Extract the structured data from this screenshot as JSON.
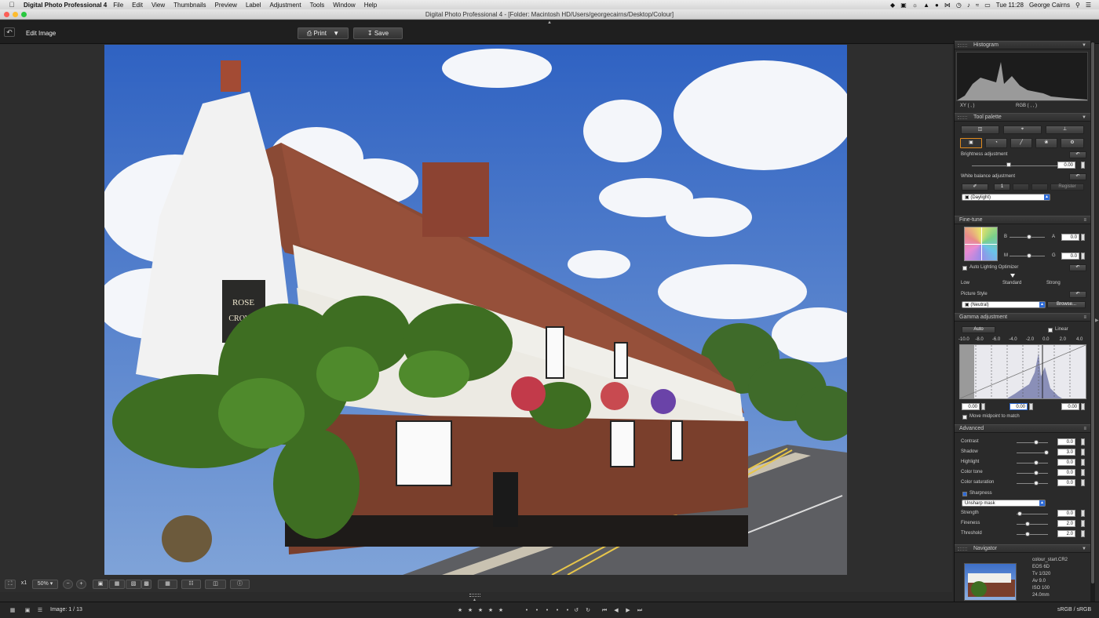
{
  "menubar": {
    "app_name": "Digital Photo Professional 4",
    "items": [
      "File",
      "Edit",
      "View",
      "Thumbnails",
      "Preview",
      "Label",
      "Adjustment",
      "Tools",
      "Window",
      "Help"
    ],
    "clock": "Tue 11:28",
    "user": "George Cairns"
  },
  "window": {
    "title": "Digital Photo Professional 4 - [Folder: Macintosh HD/Users/georgecairns/Desktop/Colour]"
  },
  "toolbar": {
    "mode_title": "Edit Image",
    "print_label": "Print",
    "save_label": "Save"
  },
  "histogram_panel": {
    "title": "Histogram",
    "xy_readout": "XY (          ,          )",
    "rgb_readout": "RGB (          ,          ,          )"
  },
  "tool_palette": {
    "title": "Tool palette",
    "brightness_label": "Brightness adjustment",
    "brightness_value": "0.00",
    "white_balance_label": "White balance adjustment",
    "wb_value": "1",
    "wb_register": "Register",
    "wb_preset": "(Daylight)"
  },
  "fine_tune": {
    "title": "Fine-tune",
    "b_label": "B",
    "a_label": "A",
    "m_label": "M",
    "g_label": "G",
    "ba_value": "0.0",
    "mg_value": "0.0",
    "alo_label": "Auto Lighting Optimizer",
    "alo_low": "Low",
    "alo_standard": "Standard",
    "alo_strong": "Strong",
    "picture_style_label": "Picture Style",
    "picture_style_value": "(Neutral)",
    "browse_label": "Browse..."
  },
  "gamma": {
    "title": "Gamma adjustment",
    "auto_label": "Auto",
    "linear_label": "Linear",
    "scale": [
      "-10.0",
      "-8.0",
      "-6.0",
      "-4.0",
      "-2.0",
      "0.0",
      "2.0",
      "4.0"
    ],
    "black_value": "0.00",
    "mid_value": "0.00",
    "white_value": "0.00",
    "move_midpoint_label": "Move midpoint to match"
  },
  "advanced": {
    "title": "Advanced",
    "rows": [
      {
        "label": "Contrast",
        "value": "0.0",
        "level": 0.63
      },
      {
        "label": "Shadow",
        "value": "3.0",
        "level": 0.95
      },
      {
        "label": "Highlight",
        "value": "0.0",
        "level": 0.63
      },
      {
        "label": "Color tone",
        "value": "0.0",
        "level": 0.63
      },
      {
        "label": "Color saturation",
        "value": "0.0",
        "level": 0.63
      }
    ],
    "sharpness_label": "Sharpness",
    "sharpness_mode": "Unsharp mask",
    "sharp_rows": [
      {
        "label": "Strength",
        "value": "0.0",
        "level": 0.1
      },
      {
        "label": "Fineness",
        "value": "2.0",
        "level": 0.35
      },
      {
        "label": "Threshold",
        "value": "2.0",
        "level": 0.35
      }
    ]
  },
  "navigator": {
    "title": "Navigator",
    "filename": "colour_start.CR2",
    "camera": "EOS 6D",
    "shutter": "Tv 1/320",
    "aperture": "Av 9.0",
    "iso": "ISO 100",
    "focal": "24.0mm"
  },
  "viewbar": {
    "multiplier": "x1",
    "zoom": "50%"
  },
  "status": {
    "image_counter": "Image: 1 / 13",
    "color_space": "sRGB / sRGB"
  },
  "photo_sign": {
    "line1": "ROSE",
    "line2": "CROWN"
  },
  "colors": {
    "sky": "#3d6fc8",
    "panel": "#2a2a2a",
    "accent": "#2e6bd7"
  }
}
